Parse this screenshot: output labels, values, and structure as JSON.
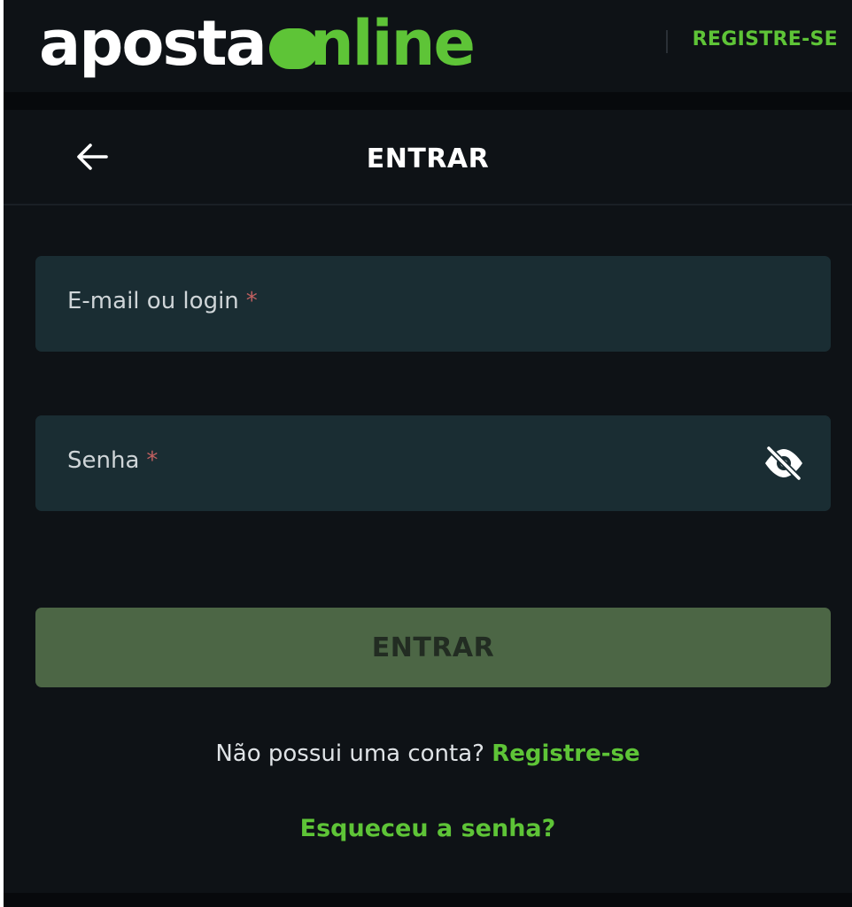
{
  "header": {
    "logo_part1": "aposta",
    "logo_part2": "nline",
    "register_label": "REGISTRE-SE"
  },
  "nav": {
    "back_icon": "arrow-left-icon",
    "title": "ENTRAR"
  },
  "form": {
    "email_label": "E-mail ou login",
    "password_label": "Senha",
    "required_marker": "*",
    "password_toggle_icon": "eye-off-icon",
    "submit_label": "ENTRAR"
  },
  "footer": {
    "no_account_text": "Não possui uma conta?",
    "register_link": "Registre-se",
    "forgot_link": "Esqueceu a senha?"
  },
  "colors": {
    "accent_green": "#5ec437",
    "background": "#0e1216",
    "field_background": "#1a2d33",
    "button_disabled": "#4c6645",
    "required_marker": "#c06060"
  }
}
